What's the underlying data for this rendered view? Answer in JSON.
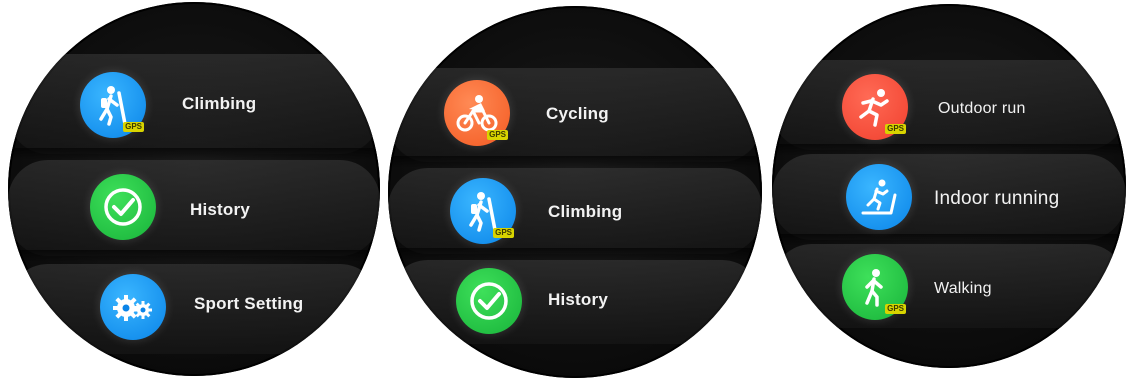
{
  "watch1": {
    "items": [
      {
        "label": "Climbing",
        "icon": "climbing-icon",
        "color": "#1e9bf5",
        "badge": "GPS"
      },
      {
        "label": "History",
        "icon": "check-clock-icon",
        "color": "#22c544",
        "badge": ""
      },
      {
        "label": "Sport Setting",
        "icon": "gears-icon",
        "color": "#1e9bf5",
        "badge": ""
      }
    ]
  },
  "watch2": {
    "items": [
      {
        "label": "Cycling",
        "icon": "cycling-icon",
        "color": "#f46c3a",
        "badge": "GPS"
      },
      {
        "label": "Climbing",
        "icon": "climbing-icon",
        "color": "#1e9bf5",
        "badge": "GPS"
      },
      {
        "label": "History",
        "icon": "check-clock-icon",
        "color": "#22c544",
        "badge": ""
      }
    ]
  },
  "watch3": {
    "items": [
      {
        "label": "Outdoor run",
        "icon": "running-icon",
        "color": "#f5503c",
        "badge": "GPS"
      },
      {
        "label": "Indoor running",
        "icon": "treadmill-icon",
        "color": "#1e9bf5",
        "badge": ""
      },
      {
        "label": "Walking",
        "icon": "walking-icon",
        "color": "#22c544",
        "badge": "GPS"
      }
    ]
  }
}
